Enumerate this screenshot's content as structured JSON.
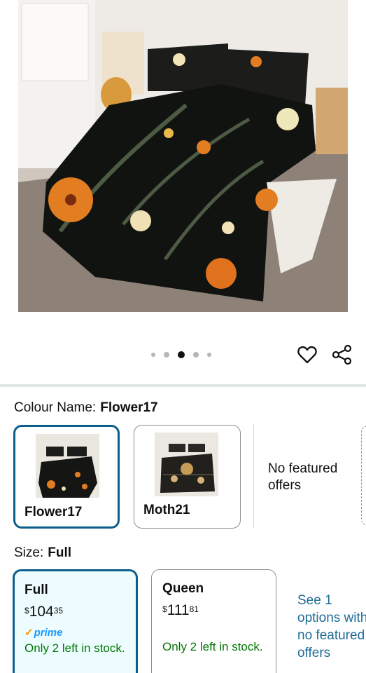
{
  "product": {
    "image_alt": "Black botanical floral comforter set on bed",
    "carousel": {
      "total": 5,
      "active": 3
    }
  },
  "actions": {
    "wishlist_icon": "heart-icon",
    "share_icon": "share-icon"
  },
  "colour": {
    "label": "Colour Name:",
    "selected": "Flower17",
    "options": [
      {
        "name": "Flower17",
        "selected": true
      },
      {
        "name": "Moth21",
        "selected": false
      }
    ],
    "no_offers": "No featured offers"
  },
  "size": {
    "label": "Size:",
    "selected": "Full",
    "options": [
      {
        "name": "Full",
        "symbol": "$",
        "whole": "104",
        "fraction": "35",
        "prime": "prime",
        "stock": "Only 2 left in stock.",
        "selected": true
      },
      {
        "name": "Queen",
        "symbol": "$",
        "whole": "111",
        "fraction": "81",
        "stock": "Only 2 left in stock.",
        "selected": false
      }
    ],
    "see_options": "See 1 options with no featured offers"
  },
  "colors": {
    "accent": "#0c5f8a",
    "selected_bg": "#edfdff",
    "stock": "#007600",
    "link": "#1f6c96",
    "prime": "#1a98ff"
  }
}
